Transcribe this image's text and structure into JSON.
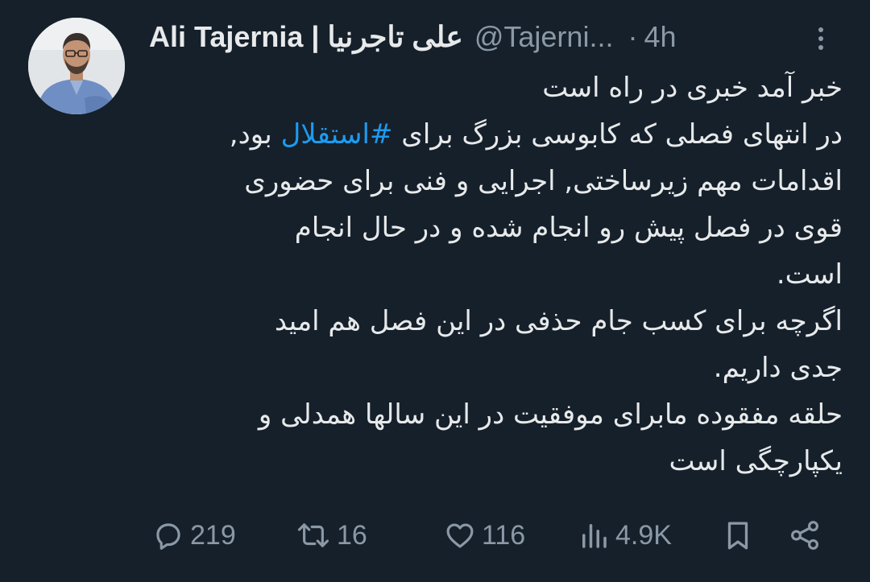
{
  "tweet": {
    "author_name": "Ali Tajernia | علی تاجرنیا",
    "author_handle": "@Tajerni...",
    "separator": "·",
    "time": "4h",
    "text_lines": [
      {
        "parts": [
          {
            "text": "خبر آمد خبری در راه است"
          }
        ]
      },
      {
        "parts": [
          {
            "text": "در انتهای فصلی که کابوسی بزرگ برای "
          },
          {
            "text": "#استقلال",
            "hashtag": true
          },
          {
            "text": " بود,"
          }
        ]
      },
      {
        "parts": [
          {
            "text": "اقدامات مهم زیرساختی, اجرایی و فنی برای حضوری"
          }
        ]
      },
      {
        "parts": [
          {
            "text": "قوی در فصل پیش رو انجام شده و در حال انجام"
          }
        ]
      },
      {
        "parts": [
          {
            "text": "است."
          }
        ]
      },
      {
        "parts": [
          {
            "text": "اگرچه برای کسب جام حذفی در این فصل هم امید"
          }
        ]
      },
      {
        "parts": [
          {
            "text": "جدی داریم."
          }
        ]
      },
      {
        "parts": [
          {
            "text": "حلقه مفقوده مابرای موفقیت در این سالها همدلی و"
          }
        ]
      },
      {
        "parts": [
          {
            "text": "یکپارچگی است"
          }
        ]
      }
    ]
  },
  "actions": {
    "replies": {
      "icon": "reply-icon",
      "count": "219"
    },
    "retweets": {
      "icon": "retweet-icon",
      "count": "16"
    },
    "likes": {
      "icon": "heart-icon",
      "count": "116"
    },
    "views": {
      "icon": "views-icon",
      "count": "4.9K"
    },
    "bookmark": {
      "icon": "bookmark-icon"
    },
    "share": {
      "icon": "share-icon"
    }
  },
  "colors": {
    "background": "#15202b",
    "text": "#e7e9ea",
    "secondary": "#8b98a5",
    "accent": "#1d9bf0"
  }
}
